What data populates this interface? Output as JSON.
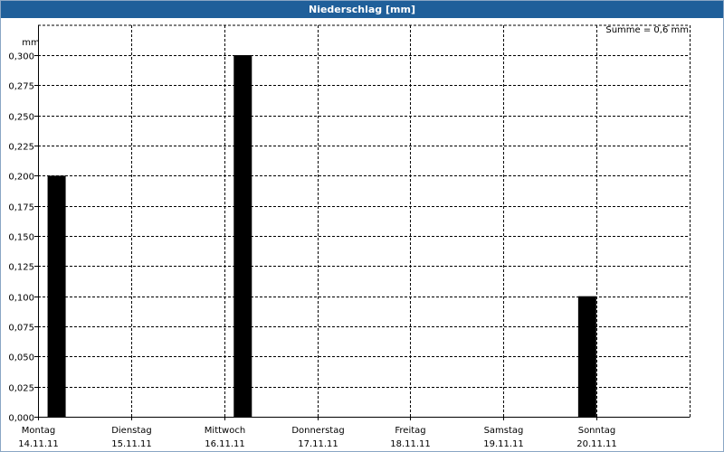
{
  "window": {
    "title": "Niederschlag [mm]"
  },
  "chart_data": {
    "type": "bar",
    "title": "Niederschlag [mm]",
    "ylabel": "mm",
    "sum_label": "Summe = 0,6 mm",
    "categories": [
      {
        "day": "Montag",
        "date": "14.11.11"
      },
      {
        "day": "Dienstag",
        "date": "15.11.11"
      },
      {
        "day": "Mittwoch",
        "date": "16.11.11"
      },
      {
        "day": "Donnerstag",
        "date": "17.11.11"
      },
      {
        "day": "Freitag",
        "date": "18.11.11"
      },
      {
        "day": "Samstag",
        "date": "19.11.11"
      },
      {
        "day": "Sonntag",
        "date": "20.11.11"
      }
    ],
    "bars": [
      {
        "x": 0.2,
        "value": 0.2
      },
      {
        "x": 2.2,
        "value": 0.3
      },
      {
        "x": 5.9,
        "value": 0.1
      }
    ],
    "ylim": [
      0,
      0.3
    ],
    "xlim": [
      0,
      7
    ],
    "y_ticks": [
      "0,000",
      "0,025",
      "0,050",
      "0,075",
      "0,100",
      "0,125",
      "0,150",
      "0,175",
      "0,200",
      "0,225",
      "0,250",
      "0,275",
      "0,300"
    ],
    "grid": true,
    "colors": {
      "bar": "#000000",
      "title_bar": "#1f5f9a",
      "grid": "#000000"
    }
  }
}
